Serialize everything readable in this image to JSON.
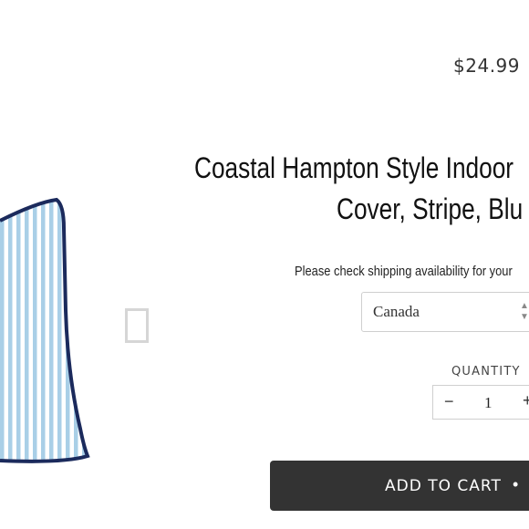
{
  "product": {
    "price": "$24.99",
    "title_line1": "Coastal Hampton Style Indoor",
    "title_line2": "Cover, Stripe, Blu"
  },
  "shipping": {
    "prompt": "Please check shipping availability for your",
    "country": "Canada"
  },
  "quantity": {
    "label": "QUANTITY",
    "value": "1",
    "minus": "−",
    "plus": "+"
  },
  "cart": {
    "label": "ADD TO CART",
    "separator": "•"
  },
  "colors": {
    "stripe": "#a9cfe7",
    "piping": "#1b2a5c",
    "button": "#333333"
  }
}
